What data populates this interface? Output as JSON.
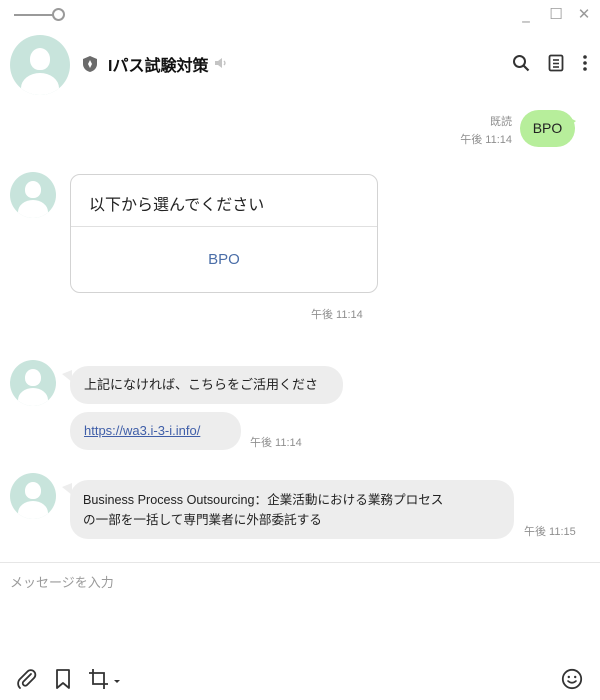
{
  "window": {
    "minimize_glyph": "_",
    "maximize_glyph": "☐",
    "close_glyph": "✕"
  },
  "header": {
    "title": "Iパス試験対策",
    "icons": [
      "shield-icon",
      "speaker-icon",
      "search-icon",
      "notes-icon",
      "more-icon"
    ]
  },
  "messages": {
    "outgoing": {
      "text": "BPO",
      "read_label": "既読",
      "time": "午後 11:14"
    },
    "card": {
      "title": "以下から選んでください",
      "option": "BPO",
      "time": "午後 11:14"
    },
    "notice": {
      "text": "上記になければ、こちらをご活用ください。"
    },
    "link": {
      "url": "https://wa3.i-3-i.info/",
      "time": "午後 11:14"
    },
    "definition": {
      "line1": "Business Process Outsourcing：企業活動における業務プロセス",
      "line2": "の一部を一括して専門業者に外部委託する",
      "time": "午後 11:15"
    }
  },
  "composer": {
    "placeholder": "メッセージを入力",
    "tools": [
      "attach-icon",
      "bookmark-icon",
      "crop-icon",
      "emoji-icon"
    ]
  },
  "colors": {
    "outgoing_bubble": "#b7ee9b",
    "incoming_bubble": "#ededed",
    "link": "#3f5ea8",
    "avatar": "#c8e4dc"
  }
}
